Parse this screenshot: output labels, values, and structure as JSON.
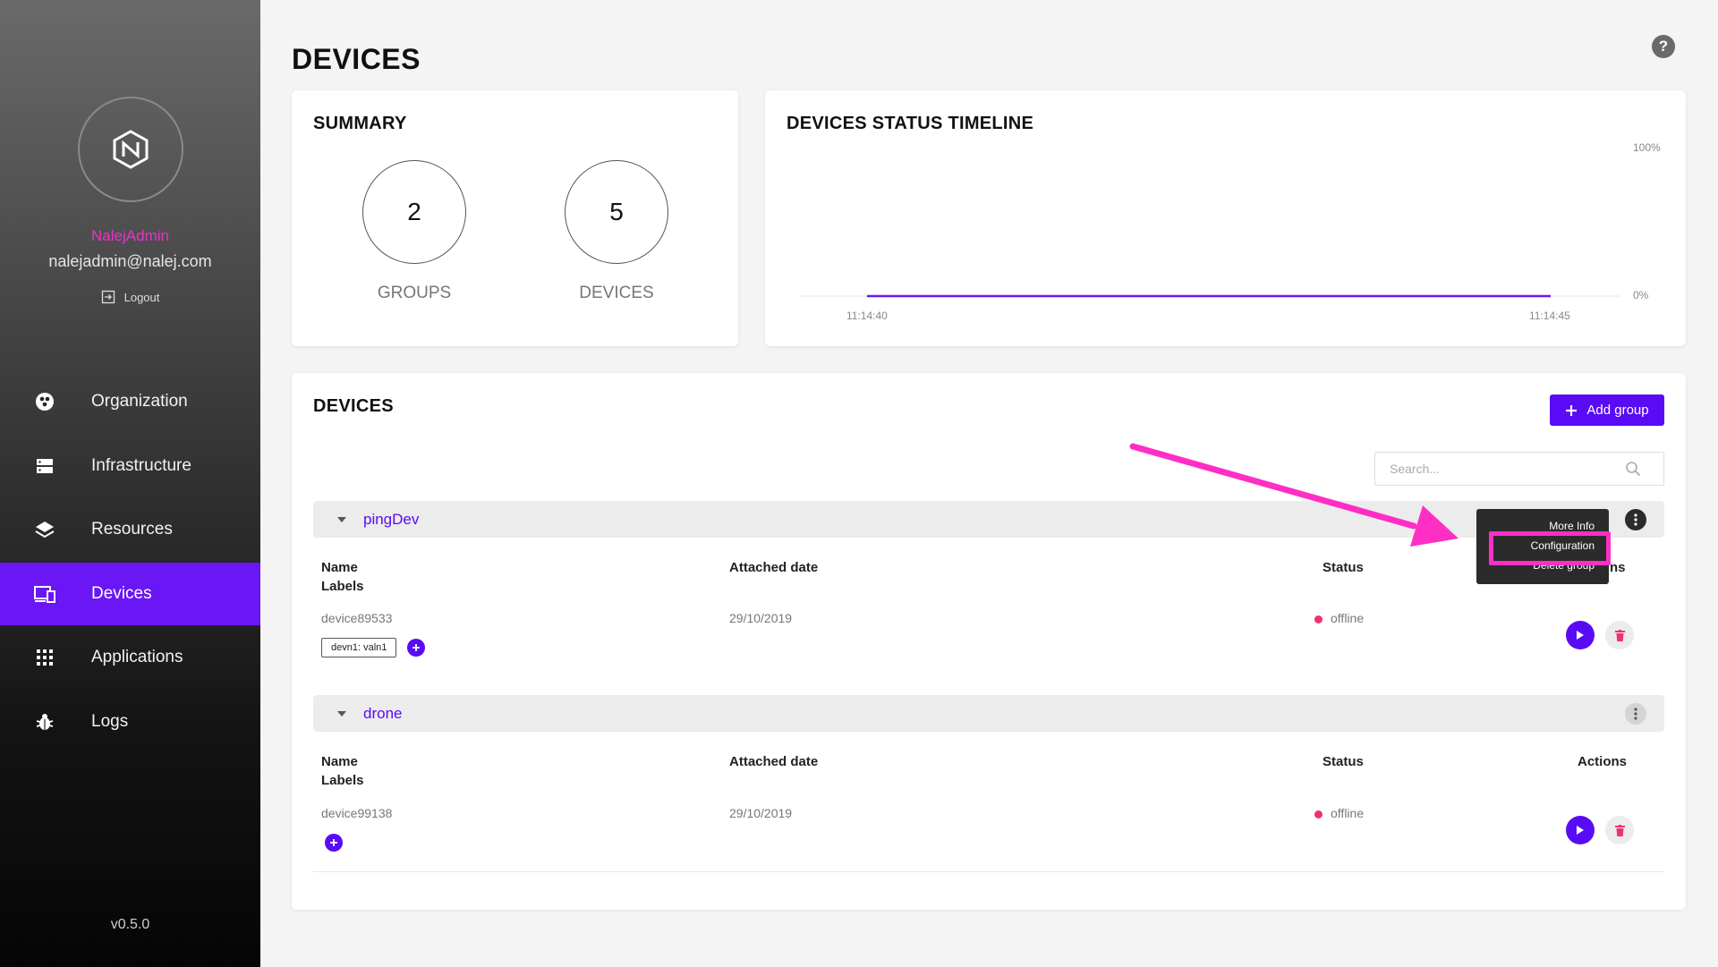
{
  "sidebar": {
    "user_name": "NalejAdmin",
    "user_email": "nalejadmin@nalej.com",
    "logout_label": "Logout",
    "items": [
      {
        "label": "Organization",
        "icon": "organization-icon"
      },
      {
        "label": "Infrastructure",
        "icon": "infrastructure-icon"
      },
      {
        "label": "Resources",
        "icon": "resources-icon"
      },
      {
        "label": "Devices",
        "icon": "devices-icon",
        "active": true
      },
      {
        "label": "Applications",
        "icon": "applications-icon"
      },
      {
        "label": "Logs",
        "icon": "logs-icon"
      }
    ],
    "version": "v0.5.0"
  },
  "page": {
    "title": "DEVICES",
    "help": "?"
  },
  "summary": {
    "title": "SUMMARY",
    "groups_count": "2",
    "groups_label": "GROUPS",
    "devices_count": "5",
    "devices_label": "DEVICES"
  },
  "timeline": {
    "title": "DEVICES STATUS TIMELINE",
    "y_top": "100%",
    "y_bottom": "0%",
    "x_start": "11:14:40",
    "x_end": "11:14:45",
    "line_color": "#6a16f5"
  },
  "devices": {
    "title": "DEVICES",
    "add_group_label": "Add group",
    "search_placeholder": "Search...",
    "columns": {
      "name": "Name",
      "labels": "Labels",
      "attached_date": "Attached date",
      "status": "Status",
      "actions": "Actions"
    },
    "groups": [
      {
        "name": "pingDev",
        "actions_header_visible": "ns",
        "device": {
          "name": "device89533",
          "label": "devn1: valn1",
          "attached_date": "29/10/2019",
          "status": "offline"
        }
      },
      {
        "name": "drone",
        "device": {
          "name": "device99138",
          "attached_date": "29/10/2019",
          "status": "offline"
        }
      }
    ]
  },
  "menu": {
    "items": [
      "More Info",
      "Configuration",
      "Delete group"
    ]
  },
  "colors": {
    "accent": "#5a0bf5",
    "status_offline": "#f0316b",
    "annotation": "#ff2ec4"
  }
}
